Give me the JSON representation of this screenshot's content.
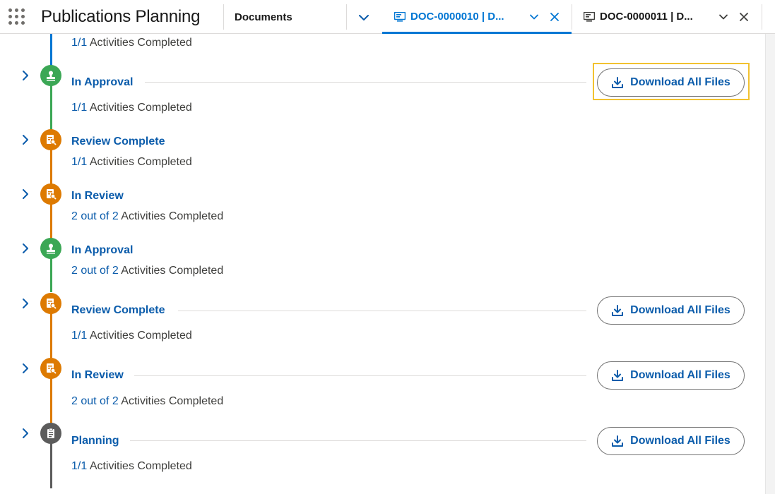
{
  "app": {
    "title": "Publications Planning"
  },
  "nav": {
    "item_label": "Documents",
    "tabs": [
      {
        "label": "DOC-0000010 | D...",
        "active": true
      },
      {
        "label": "DOC-0000011 | D...",
        "active": false
      }
    ]
  },
  "top_partial": {
    "count": "1/1",
    "suffix": " Activities Completed"
  },
  "stages": [
    {
      "title": "In Approval",
      "count": "1/1",
      "suffix": " Activities Completed",
      "icon": "approval-stamp-icon",
      "color": "#3ba755",
      "download": "Download All Files"
    },
    {
      "title": "Review Complete",
      "count": "1/1",
      "suffix": " Activities Completed",
      "icon": "review-document-icon",
      "color": "#dd7a01",
      "download": null
    },
    {
      "title": "In Review",
      "count": "2 out of 2",
      "suffix": " Activities Completed",
      "icon": "review-document-icon",
      "color": "#dd7a01",
      "download": null
    },
    {
      "title": "In Approval",
      "count": "2 out of 2",
      "suffix": " Activities Completed",
      "icon": "approval-stamp-icon",
      "color": "#3ba755",
      "download": null
    },
    {
      "title": "Review Complete",
      "count": "1/1",
      "suffix": " Activities Completed",
      "icon": "review-document-icon",
      "color": "#dd7a01",
      "download": "Download All Files"
    },
    {
      "title": "In Review",
      "count": "2 out of 2",
      "suffix": " Activities Completed",
      "icon": "review-document-icon",
      "color": "#dd7a01",
      "download": "Download All Files"
    },
    {
      "title": "Planning",
      "count": "1/1",
      "suffix": " Activities Completed",
      "icon": "planning-clipboard-icon",
      "color": "#5c5c5c",
      "download": "Download All Files"
    }
  ],
  "colors": {
    "accent": "#0176d3",
    "link": "#0b5cab",
    "highlight": "#f2c230"
  }
}
